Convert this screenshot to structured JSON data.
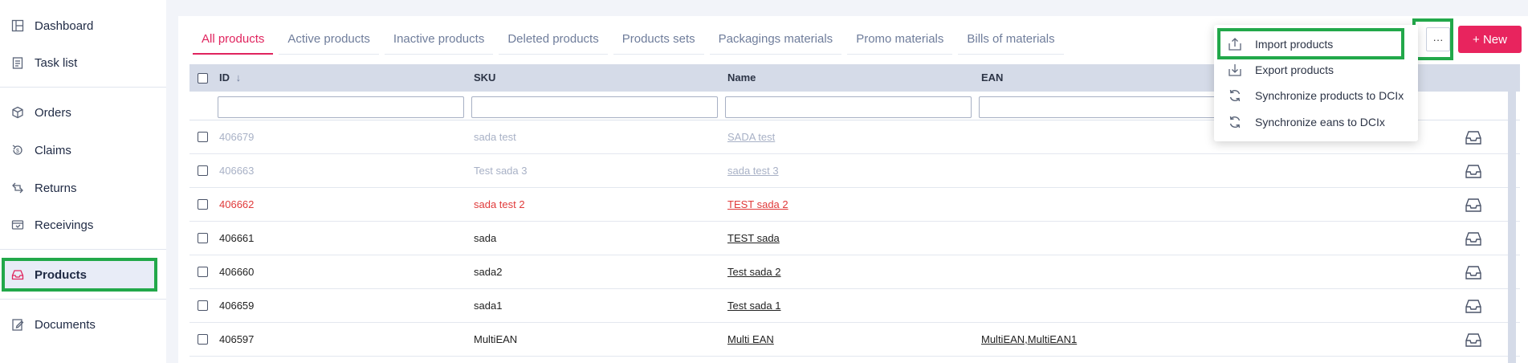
{
  "sidebar": {
    "items": [
      {
        "label": "Dashboard",
        "icon": "dashboard-icon"
      },
      {
        "label": "Task list",
        "icon": "clipboard-icon"
      },
      {
        "label": "Orders",
        "icon": "box-icon"
      },
      {
        "label": "Claims",
        "icon": "refund-icon"
      },
      {
        "label": "Returns",
        "icon": "returns-icon"
      },
      {
        "label": "Receivings",
        "icon": "receiving-icon"
      },
      {
        "label": "Products",
        "icon": "inbox-icon",
        "active": true
      },
      {
        "label": "Documents",
        "icon": "document-edit-icon"
      }
    ]
  },
  "tabs": [
    "All products",
    "Active products",
    "Inactive products",
    "Deleted products",
    "Products sets",
    "Packagings materials",
    "Promo materials",
    "Bills of materials"
  ],
  "active_tab": "All products",
  "toolbar": {
    "more_label": "···",
    "new_label": "+ New"
  },
  "table": {
    "columns": {
      "id": "ID",
      "sku": "SKU",
      "name": "Name",
      "ean": "EAN"
    },
    "sort_icon": "arrow-down-icon",
    "columns_icon": "columns-icon",
    "rows": [
      {
        "id": "406679",
        "sku": "sada test",
        "name": "SADA test",
        "ean": "",
        "status": "inactive"
      },
      {
        "id": "406663",
        "sku": "Test sada 3",
        "name": "sada test 3",
        "ean": "",
        "status": "inactive"
      },
      {
        "id": "406662",
        "sku": "sada test 2",
        "name": "TEST sada 2",
        "ean": "",
        "status": "deleted"
      },
      {
        "id": "406661",
        "sku": "sada",
        "name": "TEST sada",
        "ean": "",
        "status": "active"
      },
      {
        "id": "406660",
        "sku": "sada2",
        "name": "Test sada 2",
        "ean": "",
        "status": "active"
      },
      {
        "id": "406659",
        "sku": "sada1",
        "name": "Test sada 1",
        "ean": "",
        "status": "active"
      },
      {
        "id": "406597",
        "sku": "MultiEAN",
        "name": "Multi EAN",
        "ean": "MultiEAN,MultiEAN1",
        "status": "active"
      }
    ]
  },
  "dropdown": {
    "items": [
      {
        "label": "Import products",
        "icon": "upload-icon"
      },
      {
        "label": "Export products",
        "icon": "download-icon"
      },
      {
        "label": "Synchronize products to DCIx",
        "icon": "sync-icon"
      },
      {
        "label": "Synchronize eans to DCIx",
        "icon": "sync-icon"
      }
    ]
  },
  "colors": {
    "accent": "#e0245e",
    "highlight": "#22a84a",
    "header_bg": "#d5dbe8"
  }
}
